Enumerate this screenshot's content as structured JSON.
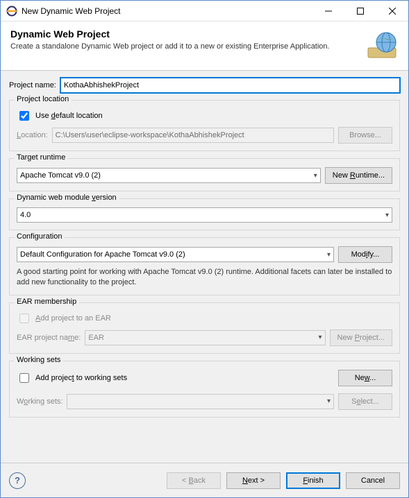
{
  "window": {
    "title": "New Dynamic Web Project"
  },
  "header": {
    "title": "Dynamic Web Project",
    "subtitle": "Create a standalone Dynamic Web project or add it to a new or existing Enterprise Application."
  },
  "projectName": {
    "label": "Project name:",
    "value": "KothaAbhishekProject"
  },
  "projectLocation": {
    "legend": "Project location",
    "useDefaultLabel": "Use default location",
    "useDefaultChecked": true,
    "locationLabel": "Location:",
    "locationValue": "C:\\Users\\user\\eclipse-workspace\\KothaAbhishekProject",
    "browse": "Browse..."
  },
  "targetRuntime": {
    "legend": "Target runtime",
    "value": "Apache Tomcat v9.0 (2)",
    "newRuntime": "New Runtime..."
  },
  "webModule": {
    "legend": "Dynamic web module version",
    "value": "4.0"
  },
  "configuration": {
    "legend": "Configuration",
    "value": "Default Configuration for Apache Tomcat v9.0 (2)",
    "modify": "Modify...",
    "description": "A good starting point for working with Apache Tomcat v9.0 (2) runtime. Additional facets can later be installed to add new functionality to the project."
  },
  "ear": {
    "legend": "EAR membership",
    "addLabel": "Add project to an EAR",
    "projectNameLabel": "EAR project name:",
    "projectNameValue": "EAR",
    "newProject": "New Project..."
  },
  "workingSets": {
    "legend": "Working sets",
    "addLabel": "Add project to working sets",
    "wsLabel": "Working sets:",
    "new": "New...",
    "select": "Select..."
  },
  "footer": {
    "back": "< Back",
    "next": "Next >",
    "finish": "Finish",
    "cancel": "Cancel"
  }
}
